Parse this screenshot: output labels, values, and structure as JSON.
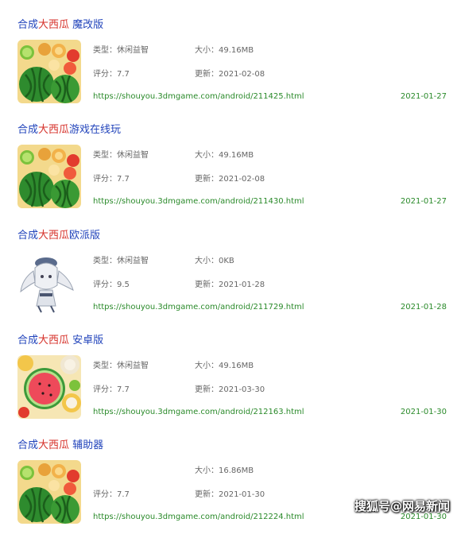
{
  "items": [
    {
      "title_pre": "合成",
      "title_hl": "大西瓜",
      "title_post": " 魔改版",
      "type_label": "类型：休闲益智",
      "size_label": "大小：49.16MB",
      "score_label": "评分：7.7",
      "update_label": "更新：2021-02-08",
      "url": "https://shouyou.3dmgame.com/android/211425.html",
      "date": "2021-01-27",
      "icon": "watermelon-game-icon"
    },
    {
      "title_pre": "合成",
      "title_hl": "大西瓜",
      "title_post": "游戏在线玩",
      "type_label": "类型：休闲益智",
      "size_label": "大小：49.16MB",
      "score_label": "评分：7.7",
      "update_label": "更新：2021-02-08",
      "url": "https://shouyou.3dmgame.com/android/211430.html",
      "date": "2021-01-27",
      "icon": "watermelon-game-icon"
    },
    {
      "title_pre": "合成",
      "title_hl": "大西瓜",
      "title_post": "欧派版",
      "type_label": "类型：休闲益智",
      "size_label": "大小：0KB",
      "score_label": "评分：9.5",
      "update_label": "更新：2021-01-28",
      "url": "https://shouyou.3dmgame.com/android/211729.html",
      "date": "2021-01-28",
      "icon": "anime-character-icon"
    },
    {
      "title_pre": "合成",
      "title_hl": "大西瓜",
      "title_post": " 安卓版",
      "type_label": "类型：休闲益智",
      "size_label": "大小：49.16MB",
      "score_label": "评分：7.7",
      "update_label": "更新：2021-03-30",
      "url": "https://shouyou.3dmgame.com/android/212163.html",
      "date": "2021-01-30",
      "icon": "sliced-watermelon-icon"
    },
    {
      "title_pre": "合成",
      "title_hl": "大西瓜",
      "title_post": " 辅助器",
      "type_label": "",
      "size_label": "大小：16.86MB",
      "score_label": "评分：7.7",
      "update_label": "更新：2021-01-30",
      "url": "https://shouyou.3dmgame.com/android/212224.html",
      "date": "2021-01-30",
      "icon": "watermelon-game-icon"
    }
  ],
  "watermark": "搜狐号@网易新闻",
  "colors": {
    "link_blue": "#2244bb",
    "highlight_red": "#d6322b",
    "url_green": "#2a8a2a"
  }
}
